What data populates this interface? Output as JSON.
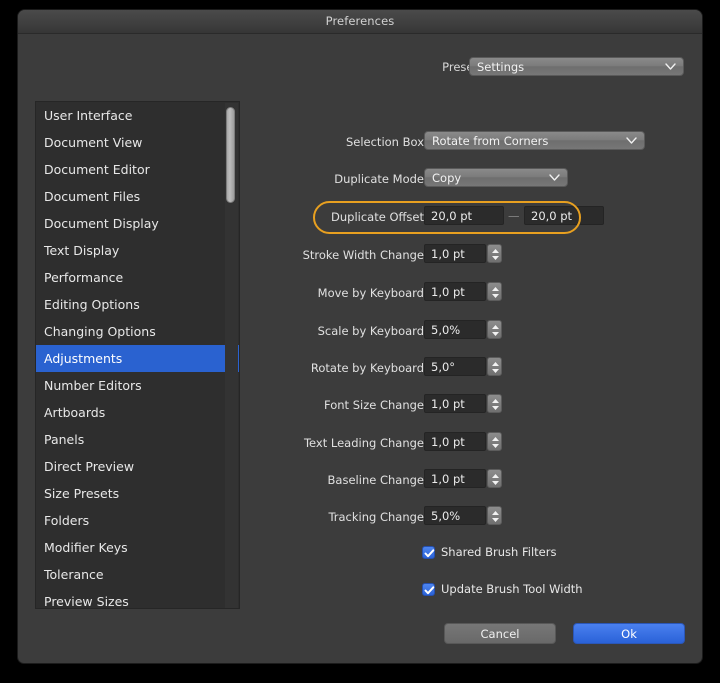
{
  "window": {
    "title": "Preferences"
  },
  "presets": {
    "label": "Presets",
    "value": "Settings",
    "icon": "chevron-down-icon"
  },
  "sidebar": {
    "items": [
      {
        "label": "User Interface",
        "selected": false
      },
      {
        "label": "Document View",
        "selected": false
      },
      {
        "label": "Document Editor",
        "selected": false
      },
      {
        "label": "Document Files",
        "selected": false
      },
      {
        "label": "Document Display",
        "selected": false
      },
      {
        "label": "Text Display",
        "selected": false
      },
      {
        "label": "Performance",
        "selected": false
      },
      {
        "label": "Editing Options",
        "selected": false
      },
      {
        "label": "Changing Options",
        "selected": false
      },
      {
        "label": "Adjustments",
        "selected": true
      },
      {
        "label": "Number Editors",
        "selected": false
      },
      {
        "label": "Artboards",
        "selected": false
      },
      {
        "label": "Panels",
        "selected": false
      },
      {
        "label": "Direct Preview",
        "selected": false
      },
      {
        "label": "Size Presets",
        "selected": false
      },
      {
        "label": "Folders",
        "selected": false
      },
      {
        "label": "Modifier Keys",
        "selected": false
      },
      {
        "label": "Tolerance",
        "selected": false
      },
      {
        "label": "Preview Sizes",
        "selected": false
      }
    ]
  },
  "form": {
    "selection_box": {
      "label": "Selection Box",
      "value": "Rotate from Corners"
    },
    "duplicate_mode": {
      "label": "Duplicate Mode",
      "value": "Copy"
    },
    "duplicate_offset": {
      "label": "Duplicate Offset",
      "value_x": "20,0 pt",
      "value_y": "20,0 pt",
      "separator": "—",
      "highlight_color": "#e8a020"
    },
    "stroke_width_change": {
      "label": "Stroke Width Change",
      "value": "1,0 pt"
    },
    "move_by_keyboard": {
      "label": "Move by Keyboard",
      "value": "1,0 pt"
    },
    "scale_by_keyboard": {
      "label": "Scale by Keyboard",
      "value": "5,0%"
    },
    "rotate_by_keyboard": {
      "label": "Rotate by Keyboard",
      "value": "5,0°"
    },
    "font_size_change": {
      "label": "Font Size Change",
      "value": "1,0 pt"
    },
    "text_leading_change": {
      "label": "Text Leading Change",
      "value": "1,0 pt"
    },
    "baseline_change": {
      "label": "Baseline Change",
      "value": "1,0 pt"
    },
    "tracking_change": {
      "label": "Tracking Change",
      "value": "5,0%"
    },
    "shared_brush_filters": {
      "label": "Shared Brush Filters",
      "checked": true
    },
    "update_brush_tool_width": {
      "label": "Update Brush Tool Width",
      "checked": true
    }
  },
  "footer": {
    "cancel_label": "Cancel",
    "ok_label": "Ok",
    "accent_color": "#2a62d8"
  }
}
